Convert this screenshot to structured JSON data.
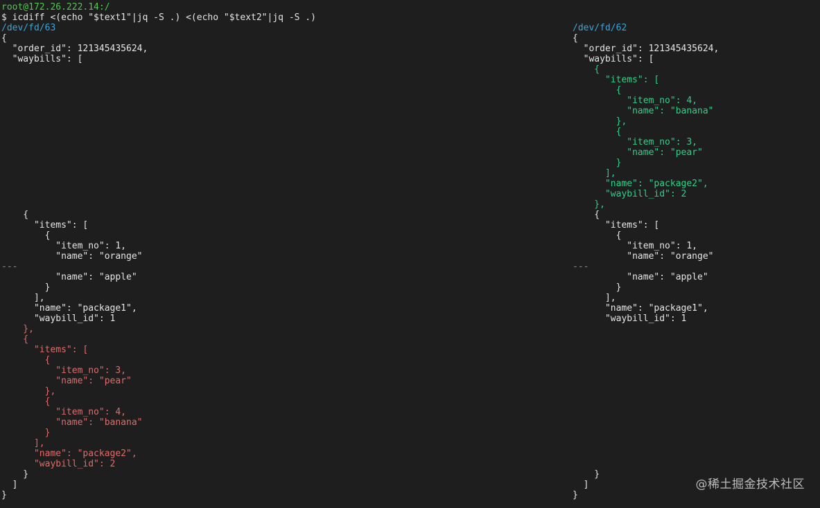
{
  "terminal": {
    "prompt": "root@172.26.222.14:/",
    "command": "$ icdiff <(echo \"$text1\"|jq -S .) <(echo \"$text2\"|jq -S .)"
  },
  "left": {
    "header": "/dev/fd/63",
    "lines": [
      {
        "text": "{",
        "style": "plain"
      },
      {
        "text": "  \"order_id\": 121345435624,",
        "style": "plain"
      },
      {
        "text": "  \"waybills\": [",
        "style": "plain"
      },
      {
        "text": "    {",
        "style": "plain"
      },
      {
        "text": "      \"items\": [",
        "style": "plain"
      },
      {
        "text": "        {",
        "style": "plain"
      },
      {
        "text": "          \"item_no\": 1,",
        "style": "plain"
      },
      {
        "text": "          \"name\": \"orange\"",
        "style": "plain"
      },
      {
        "text": "---",
        "style": "sep"
      },
      {
        "text": "          \"name\": \"apple\"",
        "style": "plain"
      },
      {
        "text": "        }",
        "style": "plain"
      },
      {
        "text": "      ],",
        "style": "plain"
      },
      {
        "text": "      \"name\": \"package1\",",
        "style": "plain"
      },
      {
        "text": "      \"waybill_id\": 1",
        "style": "plain"
      },
      {
        "text": "    },",
        "style": "del"
      },
      {
        "text": "    {",
        "style": "del"
      },
      {
        "text": "      \"items\": [",
        "style": "del"
      },
      {
        "text": "        {",
        "style": "del"
      },
      {
        "text": "          \"item_no\": 3,",
        "style": "del"
      },
      {
        "text": "          \"name\": \"pear\"",
        "style": "del"
      },
      {
        "text": "        },",
        "style": "del"
      },
      {
        "text": "        {",
        "style": "del"
      },
      {
        "text": "          \"item_no\": 4,",
        "style": "del"
      },
      {
        "text": "          \"name\": \"banana\"",
        "style": "del"
      },
      {
        "text": "        }",
        "style": "del"
      },
      {
        "text": "      ],",
        "style": "del"
      },
      {
        "text": "      \"name\": \"package2\",",
        "style": "del"
      },
      {
        "text": "      \"waybill_id\": 2",
        "style": "del"
      },
      {
        "text": "    }",
        "style": "plain"
      },
      {
        "text": "  ]",
        "style": "plain"
      },
      {
        "text": "}",
        "style": "plain"
      }
    ]
  },
  "right": {
    "header": "/dev/fd/62",
    "lines": [
      {
        "text": "{",
        "style": "plain"
      },
      {
        "text": "  \"order_id\": 121345435624,",
        "style": "plain"
      },
      {
        "text": "  \"waybills\": [",
        "style": "plain"
      },
      {
        "text": "    {",
        "style": "add"
      },
      {
        "text": "      \"items\": [",
        "style": "add"
      },
      {
        "text": "        {",
        "style": "add"
      },
      {
        "text": "          \"item_no\": 4,",
        "style": "add"
      },
      {
        "text": "          \"name\": \"banana\"",
        "style": "add"
      },
      {
        "text": "        },",
        "style": "add"
      },
      {
        "text": "        {",
        "style": "add"
      },
      {
        "text": "          \"item_no\": 3,",
        "style": "add"
      },
      {
        "text": "          \"name\": \"pear\"",
        "style": "add"
      },
      {
        "text": "        }",
        "style": "add"
      },
      {
        "text": "      ],",
        "style": "add"
      },
      {
        "text": "      \"name\": \"package2\",",
        "style": "add"
      },
      {
        "text": "      \"waybill_id\": 2",
        "style": "add"
      },
      {
        "text": "    },",
        "style": "add"
      },
      {
        "text": "    {",
        "style": "plain"
      },
      {
        "text": "      \"items\": [",
        "style": "plain"
      },
      {
        "text": "        {",
        "style": "plain"
      },
      {
        "text": "          \"item_no\": 1,",
        "style": "plain"
      },
      {
        "text": "          \"name\": \"orange\"",
        "style": "plain"
      },
      {
        "text": "---",
        "style": "sep"
      },
      {
        "text": "          \"name\": \"apple\"",
        "style": "plain"
      },
      {
        "text": "        }",
        "style": "plain"
      },
      {
        "text": "      ],",
        "style": "plain"
      },
      {
        "text": "      \"name\": \"package1\",",
        "style": "plain"
      },
      {
        "text": "      \"waybill_id\": 1",
        "style": "plain"
      },
      {
        "text": "    }",
        "style": "plain"
      },
      {
        "text": "  ]",
        "style": "plain"
      },
      {
        "text": "}",
        "style": "plain"
      }
    ]
  },
  "watermark": "@稀土掘金技术社区",
  "colors": {
    "background": "#1e1e1e",
    "prompt": "#4ec94e",
    "header": "#3aa6d8",
    "removed": "#e06c6c",
    "added": "#2fd08a"
  }
}
